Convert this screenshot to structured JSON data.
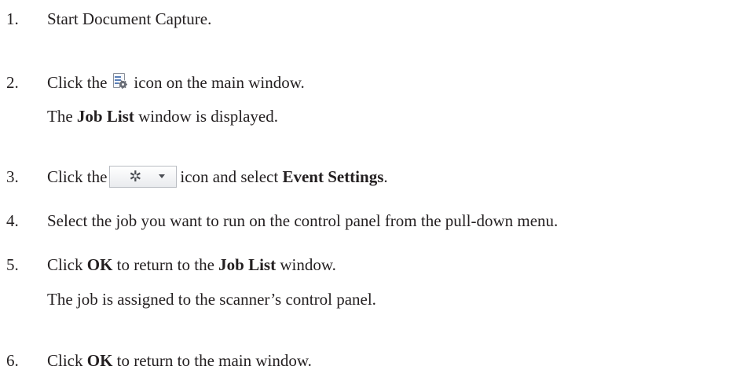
{
  "steps": [
    {
      "num": "1.",
      "text": "Start Document Capture."
    },
    {
      "num": "2.",
      "pre": "Click the",
      "post": "icon on the main window.",
      "icon": "job-list-icon",
      "note": {
        "pre": "The",
        "bold": "Job List",
        "post": "window is displayed."
      }
    },
    {
      "num": "3.",
      "pre": "Click the",
      "mid": "icon and select",
      "bold": "Event Settings",
      "post": ".",
      "icon": "gear-dropdown-icon"
    },
    {
      "num": "4.",
      "text": "Select the job you want to run on the control panel from the pull-down menu."
    },
    {
      "num": "5.",
      "pre": "Click",
      "bold1": "OK",
      "mid": "to return to the",
      "bold2": "Job List",
      "post": "window.",
      "note": {
        "text": "The job is assigned to the scanner’s control panel."
      }
    },
    {
      "num": "6.",
      "pre": "Click",
      "bold": "OK",
      "post": "to return to the main window."
    }
  ]
}
